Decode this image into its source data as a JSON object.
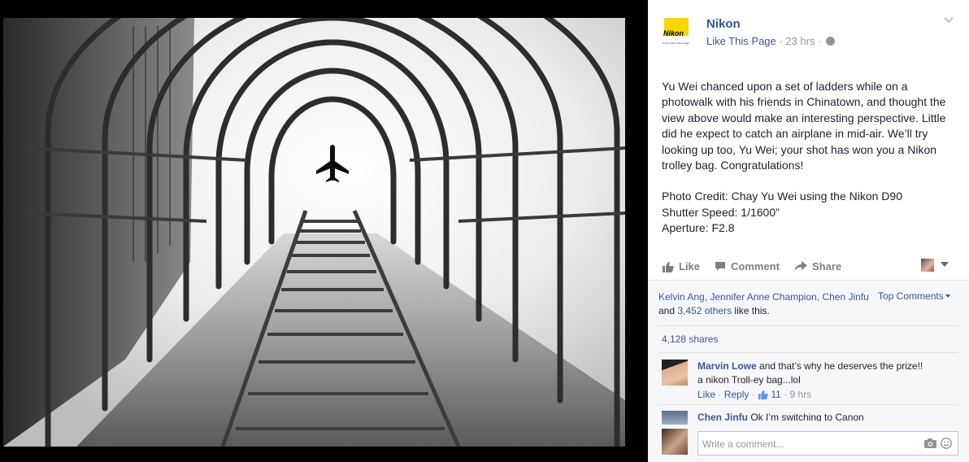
{
  "photo": {
    "subject": "ladder-and-airplane-photo"
  },
  "page": {
    "name": "Nikon",
    "logo_text": "Nikon",
    "logo_tagline": "At the heart of the image",
    "like_link": "Like This Page",
    "separator": "·",
    "timestamp": "23 hrs"
  },
  "post": {
    "body": "Yu Wei chanced upon a set of ladders while on a photowalk with his friends in Chinatown, and thought the view above would make an interesting perspective. Little did he expect to catch an airplane in mid-air. We’ll try looking up too, Yu Wei; your shot has won you a Nikon trolley bag. Congratulations!",
    "credit": "Photo Credit: Chay Yu Wei using the Nikon D90",
    "shutter": "Shutter Speed: 1/1600”",
    "aperture": "Aperture: F2.8"
  },
  "actions": {
    "like": "Like",
    "comment": "Comment",
    "share": "Share"
  },
  "engagement": {
    "names_a": "Kelvin Ang, Jennifer Anne Champion, Chen Jinfu",
    "and_1": " and ",
    "others": "3,452 others",
    "tail": " like this.",
    "top_comments": "Top Comments",
    "shares": "4,128 shares"
  },
  "comments": [
    {
      "author": "Marvin Lowe",
      "text": " and that’s why he deserves the prize!! a nikon Troll-ey bag...lol",
      "like": "Like",
      "reply": "Reply",
      "like_count": "11",
      "time": "9 hrs"
    },
    {
      "author": "Chen Jinfu",
      "text": " Ok I’m switching to Canon"
    }
  ],
  "composer": {
    "placeholder": "Write a comment..."
  },
  "colors": {
    "link": "#365899",
    "muted": "#90949c",
    "nikon_yellow": "#f7d600"
  }
}
